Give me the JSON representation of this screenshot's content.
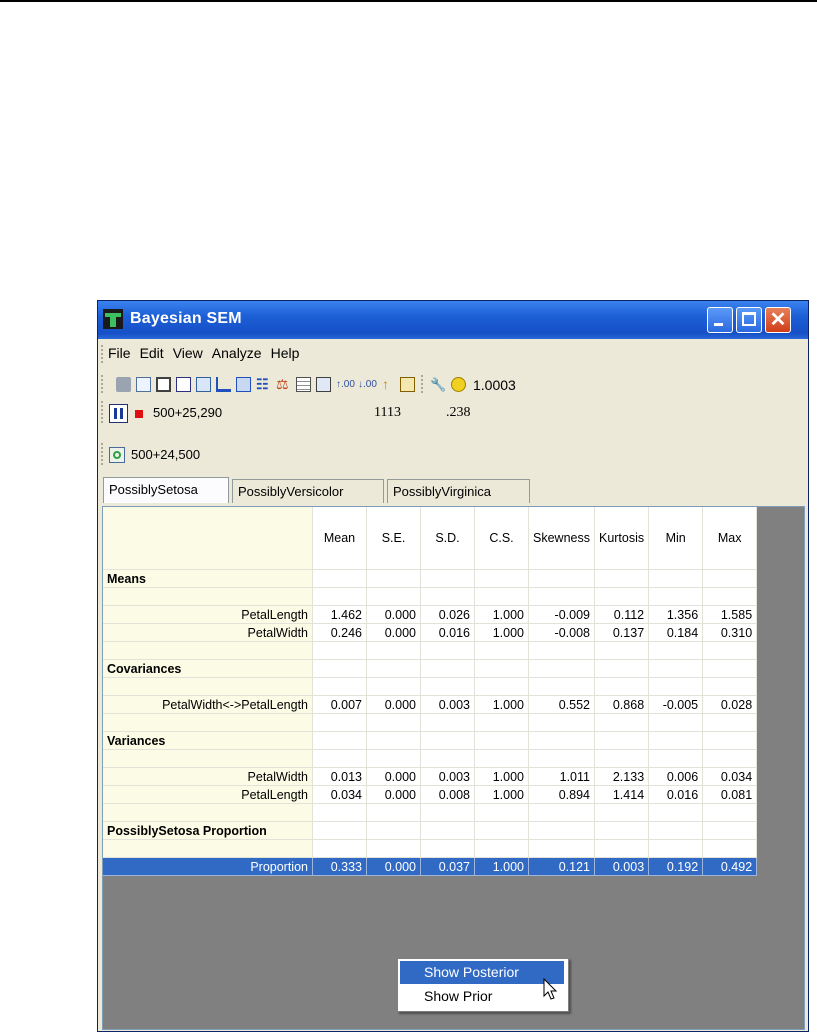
{
  "window": {
    "title": "Bayesian SEM"
  },
  "menu": [
    "File",
    "Edit",
    "View",
    "Analyze",
    "Help"
  ],
  "toolbar": {
    "convergence": "1.0003"
  },
  "status": {
    "current_samples": "500+25,290",
    "accepted": "1113",
    "rate": ".238",
    "retained_samples": "500+24,500"
  },
  "tabs": [
    "PossiblySetosa",
    "PossiblyVersicolor",
    "PossiblyVirginica"
  ],
  "table": {
    "columns": [
      "Mean",
      "S.E.",
      "S.D.",
      "C.S.",
      "Skewness",
      "Kurtosis",
      "Min",
      "Max"
    ],
    "rows": [
      {
        "label": "Means",
        "kind": "section",
        "values": []
      },
      {
        "label": "",
        "kind": "blank",
        "values": []
      },
      {
        "label": "PetalLength",
        "kind": "data",
        "values": [
          "1.462",
          "0.000",
          "0.026",
          "1.000",
          "-0.009",
          "0.112",
          "1.356",
          "1.585"
        ]
      },
      {
        "label": "PetalWidth",
        "kind": "data",
        "values": [
          "0.246",
          "0.000",
          "0.016",
          "1.000",
          "-0.008",
          "0.137",
          "0.184",
          "0.310"
        ]
      },
      {
        "label": "",
        "kind": "blank",
        "values": []
      },
      {
        "label": "Covariances",
        "kind": "section",
        "values": []
      },
      {
        "label": "",
        "kind": "blank",
        "values": []
      },
      {
        "label": "PetalWidth<->PetalLength",
        "kind": "data",
        "values": [
          "0.007",
          "0.000",
          "0.003",
          "1.000",
          "0.552",
          "0.868",
          "-0.005",
          "0.028"
        ]
      },
      {
        "label": "",
        "kind": "blank",
        "values": []
      },
      {
        "label": "Variances",
        "kind": "section",
        "values": []
      },
      {
        "label": "",
        "kind": "blank",
        "values": []
      },
      {
        "label": "PetalWidth",
        "kind": "data",
        "values": [
          "0.013",
          "0.000",
          "0.003",
          "1.000",
          "1.011",
          "2.133",
          "0.006",
          "0.034"
        ]
      },
      {
        "label": "PetalLength",
        "kind": "data",
        "values": [
          "0.034",
          "0.000",
          "0.008",
          "1.000",
          "0.894",
          "1.414",
          "0.016",
          "0.081"
        ]
      },
      {
        "label": "",
        "kind": "blank",
        "values": []
      },
      {
        "label": "PossiblySetosa Proportion",
        "kind": "section",
        "values": []
      },
      {
        "label": "",
        "kind": "blank",
        "values": []
      },
      {
        "label": "Proportion",
        "kind": "selected",
        "values": [
          "0.333",
          "0.000",
          "0.037",
          "1.000",
          "0.121",
          "0.003",
          "0.192",
          "0.492"
        ]
      }
    ]
  },
  "context_menu": {
    "items": [
      "Show Posterior",
      "Show Prior"
    ],
    "highlighted": "Show Posterior"
  },
  "colors": {
    "title_bar": "#1d5fd6",
    "selection": "#316ac5",
    "label_column": "#fbfbe6",
    "pause_button": "#1a3a9a",
    "stop_icon": "#e01010"
  }
}
